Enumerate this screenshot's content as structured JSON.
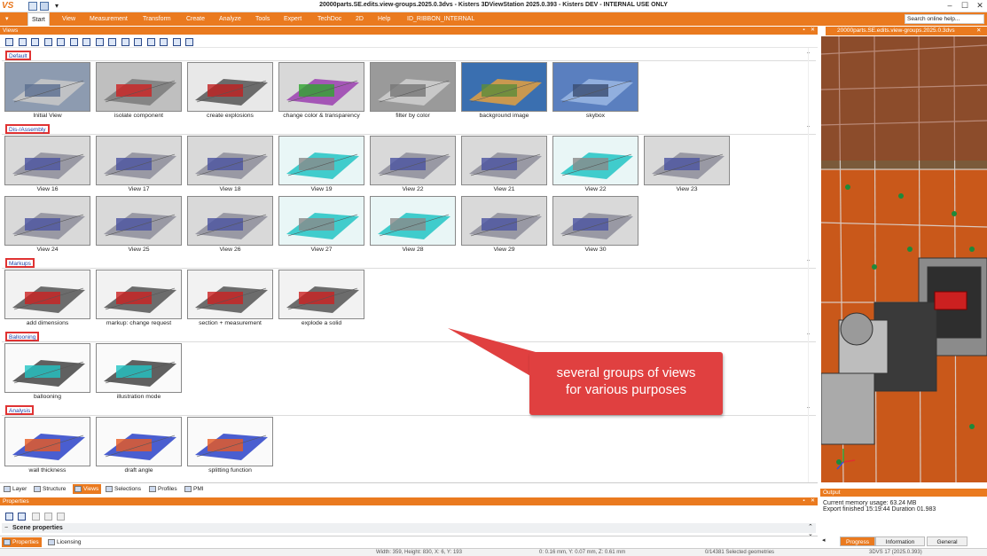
{
  "app": {
    "logo": "VS",
    "title": "20000parts.SE.edits.view-groups.2025.0.3dvs - Kisters 3DViewStation 2025.0.393 - Kisters DEV - INTERNAL USE ONLY"
  },
  "ribbon": {
    "tabs": [
      "Start",
      "View",
      "Measurement",
      "Transform",
      "Create",
      "Analyze",
      "Tools",
      "Expert",
      "TechDoc",
      "2D",
      "Help",
      "ID_RIBBON_INTERNAL"
    ],
    "active": "Start",
    "search_placeholder": "Search online help..."
  },
  "views_panel": {
    "title": "Views",
    "groups": [
      {
        "label": "Default",
        "items": [
          "Initial View",
          "isolate component",
          "create explosions",
          "change color & transparency",
          "filter by color",
          "background image",
          "skybox"
        ]
      },
      {
        "label": "Dis-/Assembly",
        "items": [
          "View 16",
          "View 17",
          "View 18",
          "View 19",
          "View 22",
          "View 21",
          "View 22",
          "View 23",
          "View 24",
          "View 25",
          "View 26",
          "View 27",
          "View 28",
          "View 29",
          "View 30"
        ]
      },
      {
        "label": "Markups",
        "items": [
          "add dimensions",
          "markup: change request",
          "section + measurement",
          "explode a solid"
        ]
      },
      {
        "label": "Ballooning",
        "items": [
          "ballooning",
          "illustration mode"
        ]
      },
      {
        "label": "Analysis",
        "items": [
          "wall thickness",
          "draft angle",
          "splitting function"
        ]
      }
    ]
  },
  "bottom_tabs": [
    "Layer",
    "Structure",
    "Views",
    "Selections",
    "Profiles",
    "PMI"
  ],
  "bottom_tabs_active": "Views",
  "properties_panel": {
    "title": "Properties",
    "scene_row": "Scene properties",
    "tabs": [
      "Properties",
      "Licensing"
    ],
    "active": "Properties"
  },
  "viewport": {
    "tab_title": "20000parts.SE.edits.view-groups.2025.0.3dvs"
  },
  "output_panel": {
    "title": "Output",
    "lines": [
      "Current memory usage: 63.24 MB",
      "Export finished 15:19:44 Duration 01.983"
    ],
    "tabs": [
      "Progress",
      "Information",
      "General"
    ],
    "active": "Progress"
  },
  "status_bar": {
    "dims": "Width: 359, Height: 830, X: 6, Y: 193",
    "coords": "0: 0.16 mm, Y: 0.07 mm, Z: 0.61 mm",
    "selection": "0/14381 Selected geometries",
    "version": "3DVS 17 (2025.0.393)"
  },
  "callout": {
    "text_line1": "several groups of views",
    "text_line2": "for various purposes"
  },
  "colors": {
    "accent": "#ea7a1f",
    "callout": "#e04040",
    "group_border": "#e03333"
  }
}
